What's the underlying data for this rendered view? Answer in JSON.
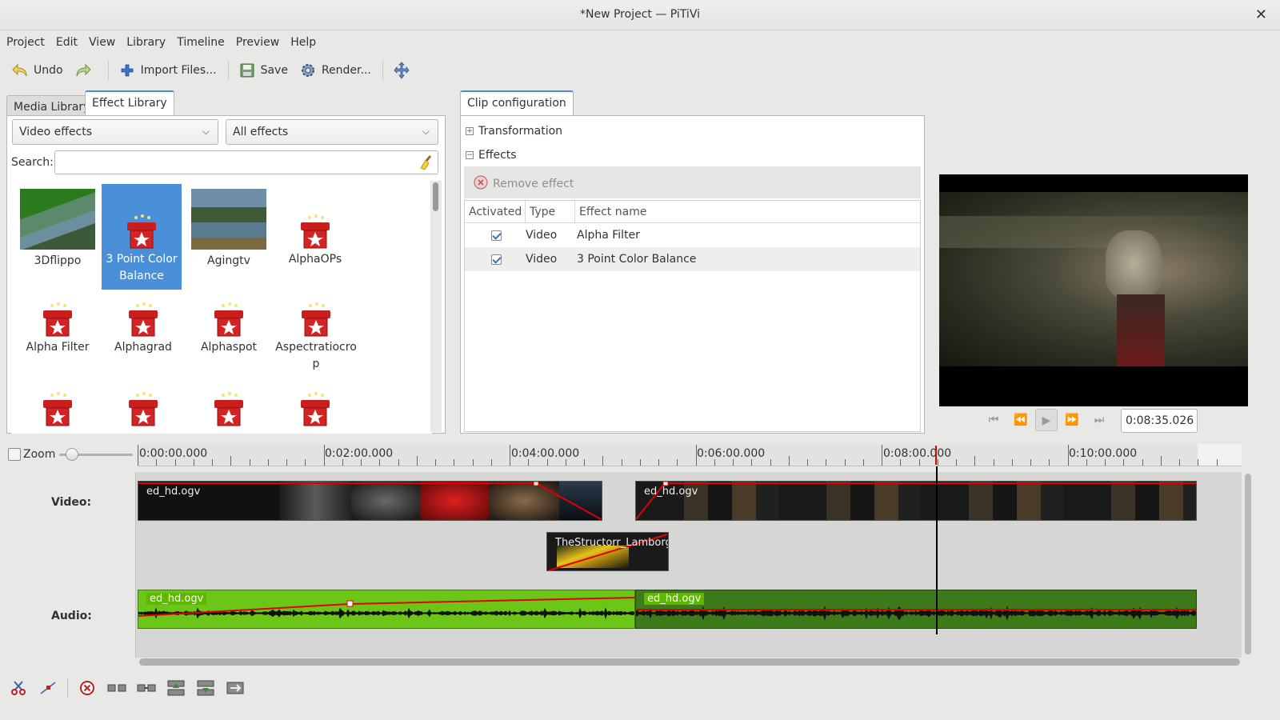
{
  "window": {
    "title": "*New Project — PiTiVi",
    "close": "✕"
  },
  "menu": [
    "Project",
    "Edit",
    "View",
    "Library",
    "Timeline",
    "Preview",
    "Help"
  ],
  "toolbar": {
    "undo": "Undo",
    "import": "Import Files...",
    "save": "Save",
    "render": "Render..."
  },
  "left_tabs": {
    "media": "Media Library",
    "effect": "Effect Library"
  },
  "filters": {
    "category": "Video effects",
    "group": "All effects"
  },
  "search": {
    "label": "Search:",
    "value": ""
  },
  "effects": [
    {
      "name": "3Dflippo",
      "thumb": "green-lake"
    },
    {
      "name": "3 Point Color Balance",
      "thumb": "gift-icon",
      "selected": true
    },
    {
      "name": "Agingtv",
      "thumb": "lake"
    },
    {
      "name": "AlphaOPs",
      "thumb": "gift-icon"
    },
    {
      "name": "Alpha Filter",
      "thumb": "gift-icon"
    },
    {
      "name": "Alphagrad",
      "thumb": "gift-icon"
    },
    {
      "name": "Alphaspot",
      "thumb": "gift-icon"
    },
    {
      "name": "Aspectratiocrop",
      "thumb": "gift-icon"
    },
    {
      "name": "",
      "thumb": "gift-icon"
    },
    {
      "name": "",
      "thumb": "gift-icon"
    },
    {
      "name": "",
      "thumb": "gift-icon"
    },
    {
      "name": "",
      "thumb": "gift-icon"
    }
  ],
  "clip_config": {
    "tab": "Clip configuration",
    "transformation": "Transformation",
    "effects": "Effects",
    "remove": "Remove effect",
    "columns": [
      "Activated",
      "Type",
      "Effect name"
    ],
    "rows": [
      {
        "activated": true,
        "type": "Video",
        "name": "Alpha Filter"
      },
      {
        "activated": true,
        "type": "Video",
        "name": "3 Point Color Balance"
      }
    ]
  },
  "viewer": {
    "timecode": "0:08:35.026"
  },
  "timeline": {
    "zoom_label": "Zoom",
    "ruler": [
      "0:00:00.000",
      "0:02:00.000",
      "0:04:00.000",
      "0:06:00.000",
      "0:08:00.000",
      "0:10:00.000"
    ],
    "tracks": {
      "video": "Video:",
      "audio": "Audio:"
    },
    "clips": {
      "v1": "ed_hd.ogv",
      "v2": "ed_hd.ogv",
      "v3": "TheStructorr_Lamborghini",
      "a1": "ed_hd.ogv",
      "a2": "ed_hd.ogv"
    }
  },
  "colors": {
    "accent": "#4a90d9",
    "audio_clip": "#6cc617",
    "audio_clip_dark": "#3d7a1a",
    "keyframe_line": "#e00000"
  }
}
